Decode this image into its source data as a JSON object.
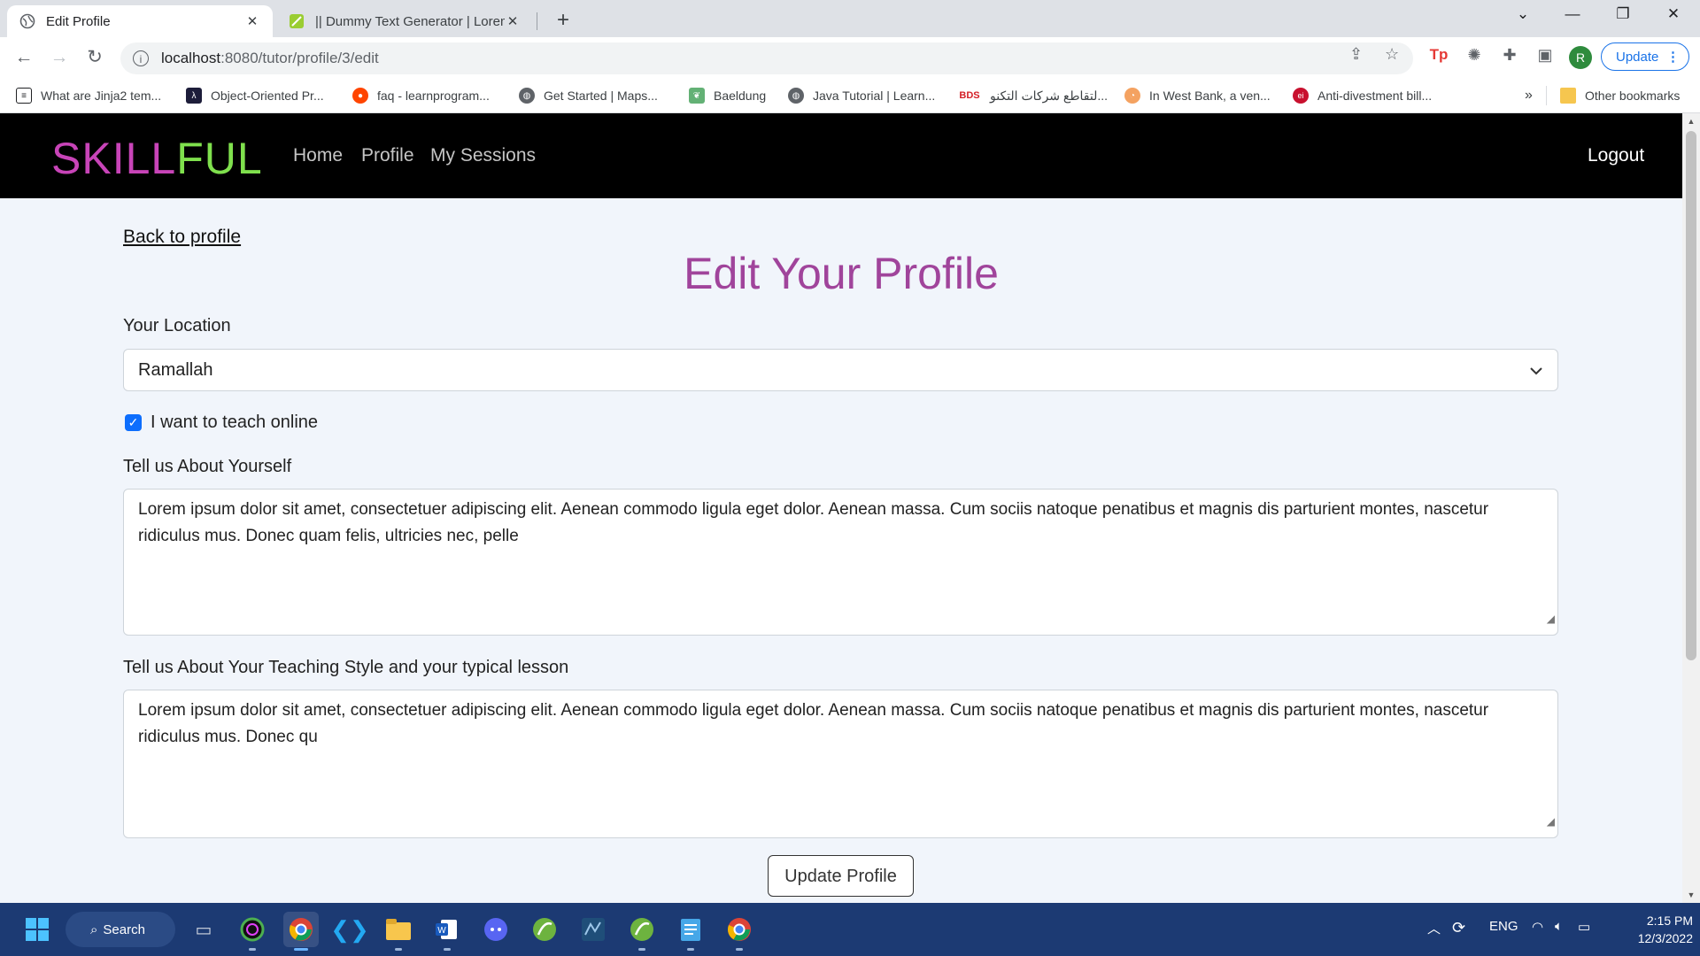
{
  "browser": {
    "tabs": [
      {
        "title": "Edit Profile",
        "active": true
      },
      {
        "title": "|| Dummy Text Generator | Lorem",
        "active": false
      }
    ],
    "url_host": "localhost",
    "url_path": ":8080/tutor/profile/3/edit",
    "update_label": "Update",
    "profile_initial": "R",
    "bookmarks": [
      {
        "label": "What are Jinja2 tem...",
        "icon": "page-icon",
        "color": "#202124"
      },
      {
        "label": "Object-Oriented Pr...",
        "icon": "lambda-icon",
        "color": "#1d1d3a"
      },
      {
        "label": "faq - learnprogram...",
        "icon": "reddit-icon",
        "color": "#ff4500"
      },
      {
        "label": "Get Started  |  Maps...",
        "icon": "globe-icon",
        "color": "#5f6368"
      },
      {
        "label": "Baeldung",
        "icon": "leaf-icon",
        "color": "#63b175"
      },
      {
        "label": "Java Tutorial | Learn...",
        "icon": "globe-icon",
        "color": "#5f6368"
      },
      {
        "label": "لتقاطع شركات التكنو...",
        "icon": "bds-icon",
        "color": "#d42027"
      },
      {
        "label": "In West Bank, a ven...",
        "icon": "swirl-icon",
        "color": "#f4a261"
      },
      {
        "label": "Anti-divestment bill...",
        "icon": "ei-icon",
        "color": "#c8102e"
      }
    ],
    "other_bookmarks": "Other bookmarks",
    "overflow": "»"
  },
  "site": {
    "brand_part1": "SKILL",
    "brand_part2": "FUL",
    "nav": [
      "Home",
      "Profile",
      "My Sessions"
    ],
    "logout": "Logout"
  },
  "form": {
    "back_link": "Back to profile",
    "title": "Edit Your Profile",
    "location_label": "Your Location",
    "location_value": "Ramallah",
    "teach_online_label": "I want to teach online",
    "teach_online_checked": true,
    "about_label": "Tell us About Yourself",
    "about_value": "Lorem ipsum dolor sit amet, consectetuer adipiscing elit. Aenean commodo ligula eget dolor. Aenean massa. Cum sociis natoque penatibus et magnis dis parturient montes, nascetur ridiculus mus. Donec quam felis, ultricies nec, pelle",
    "style_label": "Tell us About Your Teaching Style and your typical lesson",
    "style_value": "Lorem ipsum dolor sit amet, consectetuer adipiscing elit. Aenean commodo ligula eget dolor. Aenean massa. Cum sociis natoque penatibus et magnis dis parturient montes, nascetur ridiculus mus. Donec qu",
    "submit_label": "Update Profile"
  },
  "taskbar": {
    "search_label": "Search",
    "language": "ENG",
    "time": "2:15 PM",
    "date": "12/3/2022"
  },
  "colors": {
    "brand_pink": "#c844b8",
    "brand_green": "#7fe04d",
    "title_purple": "#a0449b",
    "checkbox_blue": "#0d6efd",
    "taskbar": "#1c3a73"
  }
}
